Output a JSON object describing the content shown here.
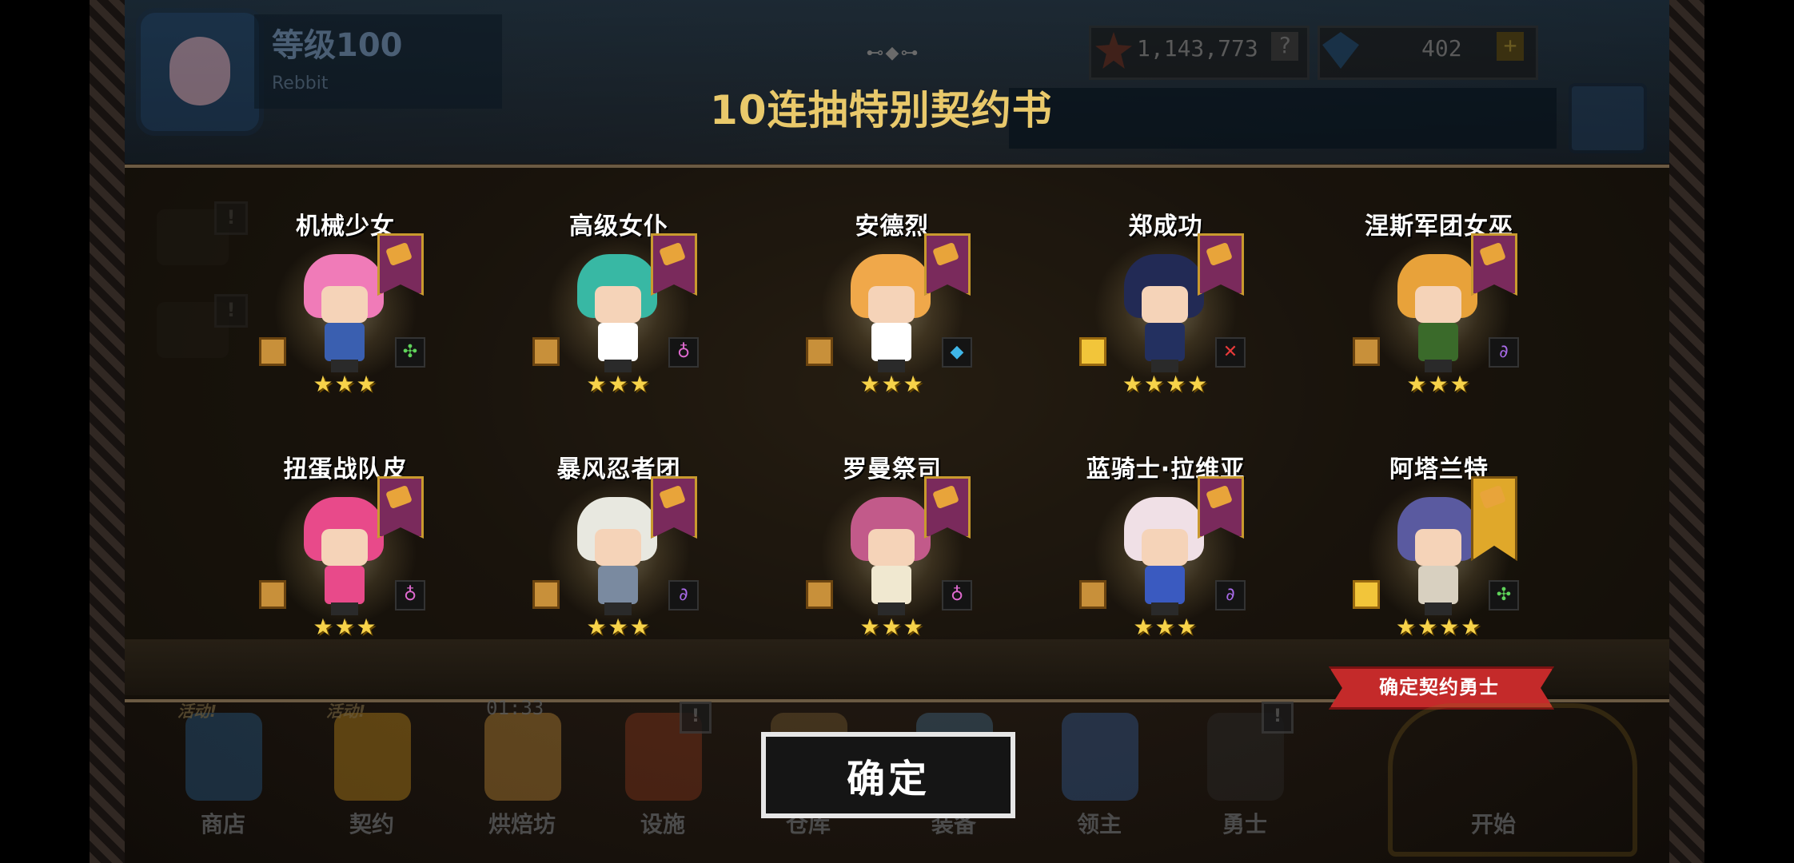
{
  "header": {
    "level_text": "等级100",
    "player_name": "Rebbit",
    "gold_amount": "1,143,773",
    "gem_amount": "402",
    "gold_icon": "star-coin-icon",
    "gem_icon": "diamond-icon",
    "help_symbol": "?",
    "add_symbol": "+"
  },
  "title": "10连抽特别契约书",
  "title_ornament": "⊷◆⊶",
  "heroes": [
    {
      "name": "机械少女",
      "stars": "★★★",
      "class_symbol": "✣",
      "class_color": "#5fd35a",
      "scroll": "bronze",
      "hair": "#f07bb8",
      "body": "#3a5fb0"
    },
    {
      "name": "高级女仆",
      "stars": "★★★",
      "class_symbol": "♁",
      "class_color": "#e06ad0",
      "scroll": "bronze",
      "hair": "#38b8a4",
      "body": "#ffffff"
    },
    {
      "name": "安德烈",
      "stars": "★★★",
      "class_symbol": "◆",
      "class_color": "#3fb6e8",
      "scroll": "bronze",
      "hair": "#f0a84a",
      "body": "#ffffff"
    },
    {
      "name": "郑成功",
      "stars": "★★★★",
      "class_symbol": "✕",
      "class_color": "#e83a3a",
      "scroll": "gold",
      "hair": "#222a55",
      "body": "#233060"
    },
    {
      "name": "涅斯军团女巫",
      "stars": "★★★",
      "class_symbol": "∂",
      "class_color": "#a86ae8",
      "scroll": "bronze",
      "hair": "#e8a23a",
      "body": "#3a6a2a"
    },
    {
      "name": "扭蛋战队皮",
      "stars": "★★★",
      "class_symbol": "♁",
      "class_color": "#e06ad0",
      "scroll": "bronze",
      "hair": "#e84a8a",
      "body": "#e84a8a"
    },
    {
      "name": "暴风忍者团",
      "stars": "★★★",
      "class_symbol": "∂",
      "class_color": "#a86ae8",
      "scroll": "bronze",
      "hair": "#e8e8e0",
      "body": "#7a8aa0"
    },
    {
      "name": "罗曼祭司",
      "stars": "★★★",
      "class_symbol": "♁",
      "class_color": "#e06ad0",
      "scroll": "bronze",
      "hair": "#c25a8a",
      "body": "#f0e8d0"
    },
    {
      "name": "蓝骑士·拉维亚",
      "stars": "★★★",
      "class_symbol": "∂",
      "class_color": "#a86ae8",
      "scroll": "bronze",
      "hair": "#f0e0e6",
      "body": "#3a5ac0"
    },
    {
      "name": "阿塔兰特",
      "stars": "★★★★",
      "class_symbol": "✣",
      "class_color": "#5fd35a",
      "scroll": "gold",
      "hair": "#5a5aa0",
      "body": "#d8d0c0"
    }
  ],
  "ribbon_text": "确定契约勇士",
  "confirm_label": "确定",
  "nav": [
    {
      "label": "商店",
      "tag": "活动!",
      "badge": "",
      "timer": ""
    },
    {
      "label": "契约",
      "tag": "活动!",
      "badge": "",
      "timer": ""
    },
    {
      "label": "烘焙坊",
      "tag": "",
      "badge": "",
      "timer": "01:33"
    },
    {
      "label": "设施",
      "tag": "",
      "badge": "!",
      "timer": ""
    },
    {
      "label": "仓库",
      "tag": "",
      "badge": "",
      "timer": ""
    },
    {
      "label": "装备",
      "tag": "",
      "badge": "",
      "timer": ""
    },
    {
      "label": "领主",
      "tag": "",
      "badge": "",
      "timer": ""
    },
    {
      "label": "勇士",
      "tag": "",
      "badge": "!",
      "timer": ""
    }
  ],
  "start_label": "开始",
  "side_badge": "!"
}
